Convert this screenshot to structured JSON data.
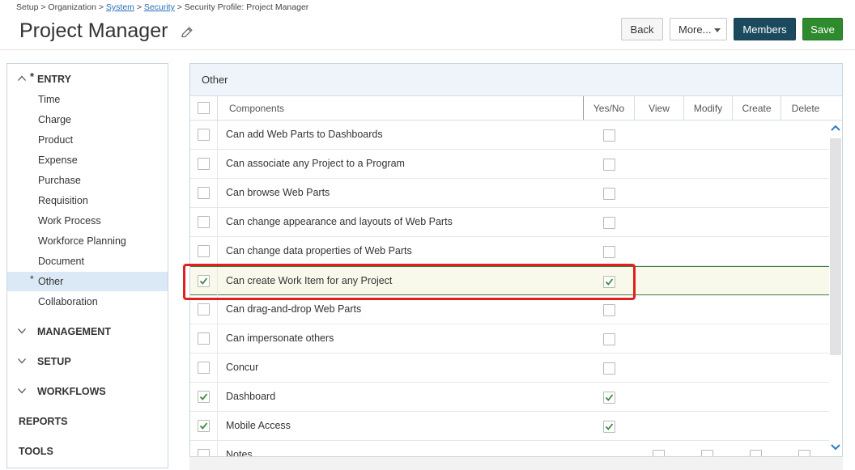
{
  "breadcrumb": {
    "part1": "Setup > Organization > ",
    "system": "System",
    "sep1": " > ",
    "security": "Security",
    "sep2": " > Security Profile: Project Manager"
  },
  "page_title": "Project Manager",
  "toolbar": {
    "back": "Back",
    "more": "More...",
    "members": "Members",
    "save": "Save"
  },
  "sidebar": {
    "entry": {
      "label": "ENTRY",
      "star": "*"
    },
    "items": [
      {
        "label": "Time"
      },
      {
        "label": "Charge"
      },
      {
        "label": "Product"
      },
      {
        "label": "Expense"
      },
      {
        "label": "Purchase"
      },
      {
        "label": "Requisition"
      },
      {
        "label": "Work Process"
      },
      {
        "label": "Workforce Planning"
      },
      {
        "label": "Document"
      },
      {
        "label": "Other",
        "star": "*",
        "active": true
      },
      {
        "label": "Collaboration"
      }
    ],
    "sections": [
      {
        "label": "MANAGEMENT"
      },
      {
        "label": "SETUP"
      },
      {
        "label": "WORKFLOWS"
      }
    ],
    "plain": [
      {
        "label": "REPORTS"
      },
      {
        "label": "TOOLS"
      }
    ]
  },
  "panel": {
    "title": "Other",
    "columns": {
      "components": "Components",
      "yesno": "Yes/No",
      "view": "View",
      "modify": "Modify",
      "create": "Create",
      "delete": "Delete"
    },
    "rows": [
      {
        "label": "Can add Web Parts to Dashboards",
        "selected": false,
        "yesno": false
      },
      {
        "label": "Can associate any Project to a Program",
        "selected": false,
        "yesno": false
      },
      {
        "label": "Can browse Web Parts",
        "selected": false,
        "yesno": false
      },
      {
        "label": "Can change appearance and layouts of Web Parts",
        "selected": false,
        "yesno": false
      },
      {
        "label": "Can change data properties of Web Parts",
        "selected": false,
        "yesno": false
      },
      {
        "label": "Can create Work Item for any Project",
        "selected": true,
        "yesno": true
      },
      {
        "label": "Can drag-and-drop Web Parts",
        "selected": false,
        "yesno": false
      },
      {
        "label": "Can impersonate others",
        "selected": false,
        "yesno": false
      },
      {
        "label": "Concur",
        "selected": false,
        "yesno": false
      },
      {
        "label": "Dashboard",
        "selected": true,
        "yesno": true
      },
      {
        "label": "Mobile Access",
        "selected": true,
        "yesno": true
      },
      {
        "label": "Notes",
        "selected": false,
        "yesno": null
      }
    ]
  },
  "colors": {
    "members_button": "#1b4a5e",
    "save_button": "#2d8a2d",
    "highlight": "#e02020",
    "checkmark": "#3c8a3c"
  }
}
